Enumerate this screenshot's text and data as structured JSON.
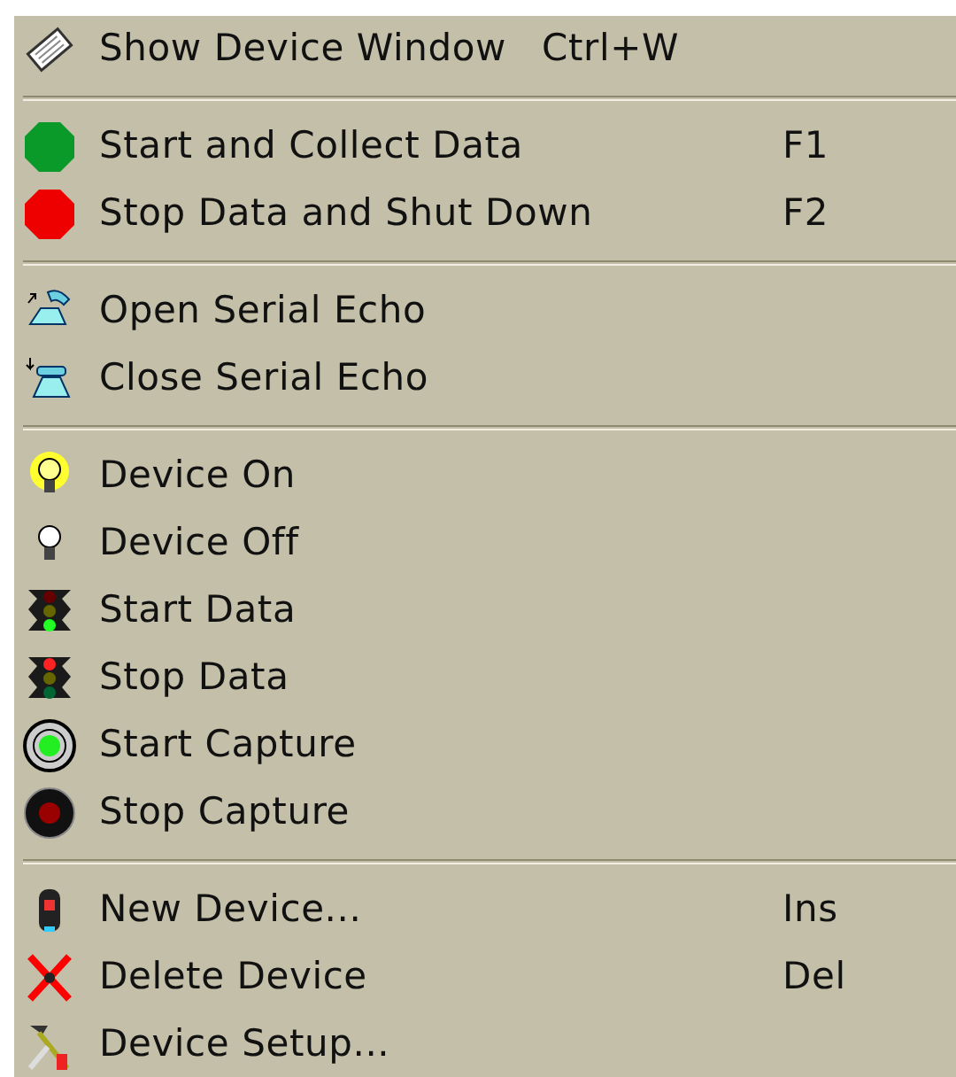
{
  "menu": {
    "sections": [
      {
        "items": [
          {
            "label": "Show Device Window",
            "shortcut": "Ctrl+W"
          }
        ]
      },
      {
        "items": [
          {
            "label": "Start and Collect Data",
            "shortcut": "F1"
          },
          {
            "label": "Stop Data and Shut Down",
            "shortcut": "F2"
          }
        ]
      },
      {
        "items": [
          {
            "label": "Open Serial Echo"
          },
          {
            "label": "Close Serial Echo"
          }
        ]
      },
      {
        "items": [
          {
            "label": "Device On"
          },
          {
            "label": "Device Off"
          },
          {
            "label": "Start Data"
          },
          {
            "label": "Stop Data"
          },
          {
            "label": "Start Capture"
          },
          {
            "label": "Stop Capture"
          }
        ]
      },
      {
        "items": [
          {
            "label": "New Device...",
            "shortcut": "Ins"
          },
          {
            "label": "Delete Device",
            "shortcut": "Del"
          },
          {
            "label": "Device Setup..."
          }
        ]
      }
    ]
  }
}
